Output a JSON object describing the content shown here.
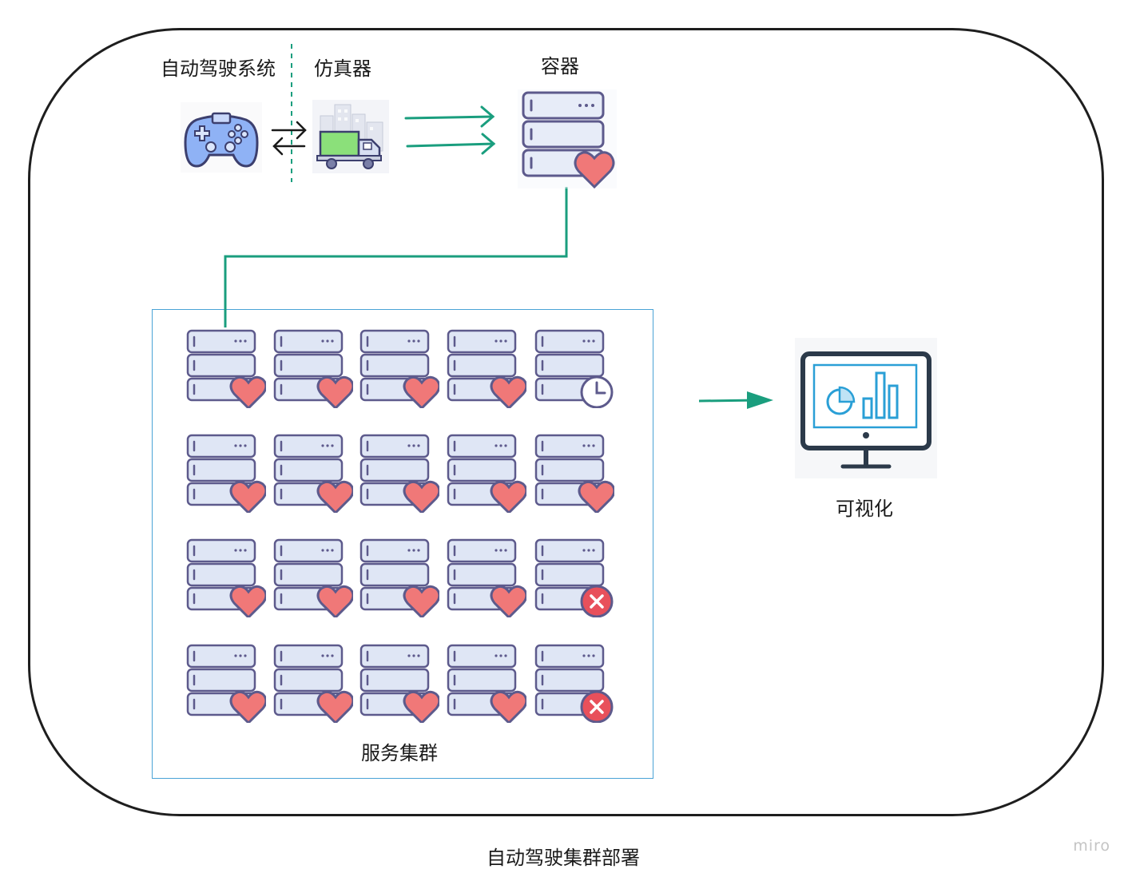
{
  "labels": {
    "autopilot": "自动驾驶系统",
    "simulator": "仿真器",
    "container": "容器",
    "cluster": "服务集群",
    "visualization": "可视化",
    "caption": "自动驾驶集群部署",
    "watermark": "miro"
  },
  "icons": {
    "gamepad": "gamepad-icon",
    "simulator": "truck-city-icon",
    "container": "server-heart-icon",
    "monitor": "monitor-chart-icon"
  },
  "cluster_grid": {
    "rows": 4,
    "cols": 5,
    "statuses": [
      [
        "healthy",
        "healthy",
        "healthy",
        "healthy",
        "pending"
      ],
      [
        "healthy",
        "healthy",
        "healthy",
        "healthy",
        "healthy"
      ],
      [
        "healthy",
        "healthy",
        "healthy",
        "healthy",
        "failed"
      ],
      [
        "healthy",
        "healthy",
        "healthy",
        "healthy",
        "failed"
      ]
    ]
  },
  "colors": {
    "arrow": "#1a9e7e",
    "frame": "#1e1e1e",
    "cluster_border": "#4aa3d6",
    "heart": "#f07878",
    "fail": "#e8505b",
    "server_fill": "#dfe6f5",
    "server_stroke": "#5d5a8c"
  }
}
